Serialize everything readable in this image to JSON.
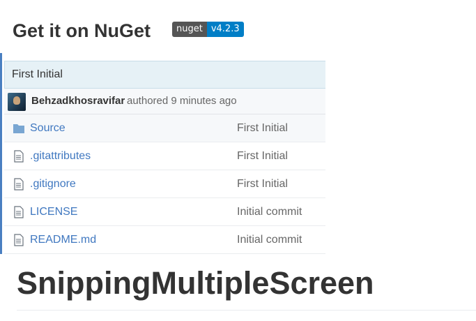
{
  "nuget_heading": "Get it on NuGet",
  "badge": {
    "label": "nuget",
    "version": "v4.2.3",
    "label_color": "#555555",
    "version_color": "#007ec6"
  },
  "repo": {
    "latest_commit": "First Initial",
    "author": "Behzadkhosravifar",
    "authored": "authored 9 minutes ago",
    "files": [
      {
        "name": "Source",
        "icon": "folder-icon",
        "message": "First Initial"
      },
      {
        "name": ".gitattributes",
        "icon": "file-icon",
        "message": "First Initial"
      },
      {
        "name": ".gitignore",
        "icon": "file-icon",
        "message": "First Initial"
      },
      {
        "name": "LICENSE",
        "icon": "file-icon",
        "message": "Initial commit"
      },
      {
        "name": "README.md",
        "icon": "file-icon",
        "message": "Initial commit"
      }
    ]
  },
  "project_title": "SnippingMultipleScreen",
  "accent_color": "#4078c0"
}
